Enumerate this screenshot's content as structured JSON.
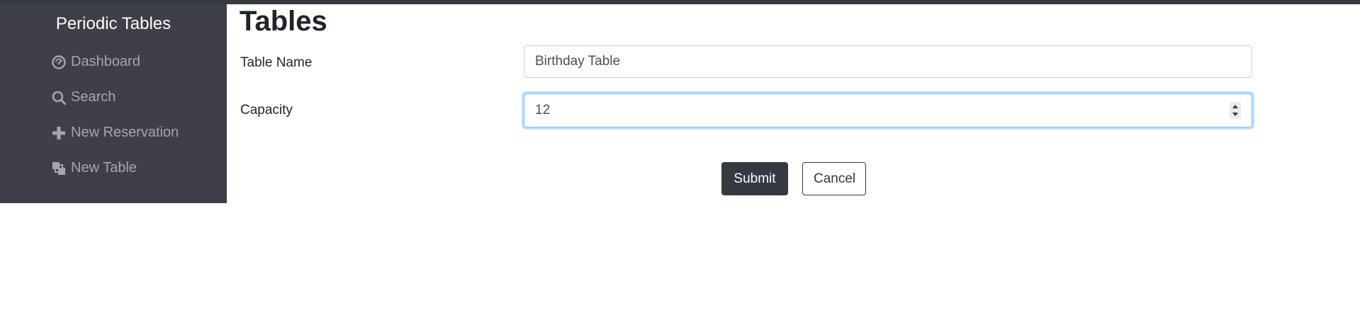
{
  "sidebar": {
    "brand": "Periodic Tables",
    "items": [
      {
        "label": "Dashboard",
        "icon": "dashboard-icon"
      },
      {
        "label": "Search",
        "icon": "search-icon"
      },
      {
        "label": "New Reservation",
        "icon": "plus-icon"
      },
      {
        "label": "New Table",
        "icon": "table-icon"
      }
    ]
  },
  "main": {
    "title": "Tables",
    "form": {
      "table_name_label": "Table Name",
      "table_name_value": "Birthday Table",
      "capacity_label": "Capacity",
      "capacity_value": "12",
      "submit_label": "Submit",
      "cancel_label": "Cancel"
    }
  },
  "colors": {
    "sidebar_bg": "#3f3f4a",
    "topbar": "#343a40",
    "primary_button": "#343a40",
    "focus_border": "#80bdff"
  }
}
